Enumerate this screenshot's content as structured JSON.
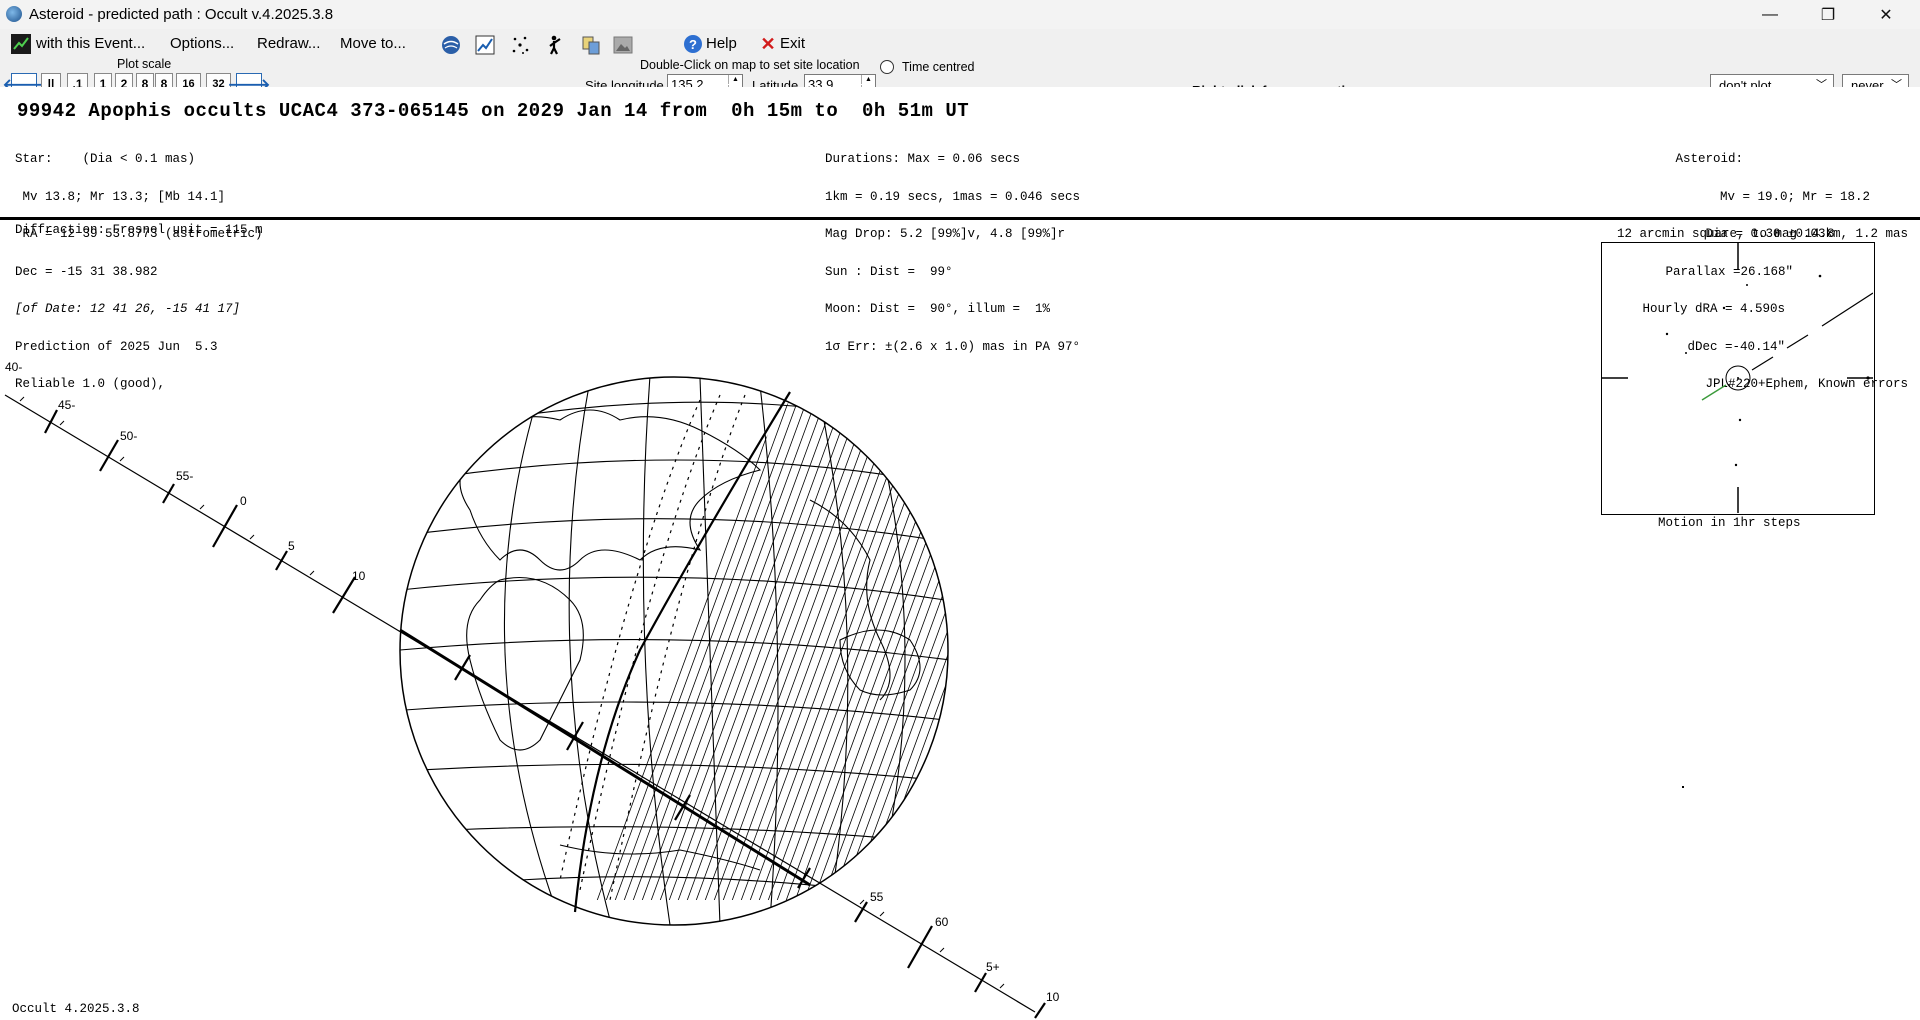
{
  "window": {
    "title": "Asteroid - predicted path : Occult v.4.2025.3.8",
    "controls": {
      "minimize": "—",
      "restore": "❐",
      "close": "✕"
    }
  },
  "menu": {
    "with_event": "with this Event...",
    "options": "Options...",
    "redraw": "Redraw...",
    "move_to": "Move to...",
    "help": "Help",
    "exit": "Exit"
  },
  "toolbar_icons": [
    "globe-icon",
    "chart-icon",
    "stars-icon",
    "observer-icon",
    "copy-icon",
    "image-icon"
  ],
  "plot_scale": {
    "label": "Plot scale",
    "pause": "||",
    "buttons": [
      ".1",
      "1",
      "2",
      "4",
      "8",
      "16",
      "32"
    ]
  },
  "site": {
    "hint": "Double-Click on map to set site location",
    "time_centred": "Time centred",
    "longitude_label": "Site longitude",
    "longitude": "135.2",
    "latitude_label": "Latitude",
    "latitude": "33.9",
    "right_click": "Right-click for menu options",
    "plot_option": "don't plot",
    "never_option": "never"
  },
  "event": {
    "heading": "99942 Apophis occults UCAC4 373-065145 on 2029 Jan 14 from  0h 15m to  0h 51m UT",
    "star": [
      "Star:    (Dia < 0.1 mas)",
      " Mv 13.8; Mr 13.3; [Mb 14.1]",
      " RA = 12 39 53.8773 (astrometric)",
      "Dec = -15 31 38.982",
      "[of Date: 12 41 26, -15 41 17]",
      "Prediction of 2025 Jun  5.3",
      "Reliable 1.0 (good),"
    ],
    "durations": [
      "Durations: Max = 0.06 secs",
      "1km = 0.19 secs, 1mas = 0.046 secs",
      "Mag Drop: 5.2 [99%]v, 4.8 [99%]r",
      "Sun : Dist =  99°",
      "Moon: Dist =  90°, illum =  1%",
      "1σ Err: ±(2.6 x 1.0) mas in PA 97°"
    ],
    "asteroid": [
      "Asteroid:",
      "Mv = 19.0; Mr = 18.2",
      "Dia = 0.30 ±0.03km, 1.2 mas",
      "Parallax =26.168\"",
      "Hourly dRA = 4.590s",
      "dDec =-40.14\"",
      "JPL#220+Ephem, Known errors"
    ],
    "diffraction": "Diffraction: Fresnel unit = 115 m",
    "finder_title": "12 arcmin square, to mag 14.8",
    "finder_caption": "Motion in 1hr steps",
    "footer": "Occult 4.2025.3.8"
  },
  "path_labels": [
    "40-",
    "45-",
    "50-",
    "55-",
    "0",
    "5",
    "10",
    "55",
    "60",
    "5+",
    "10+"
  ]
}
